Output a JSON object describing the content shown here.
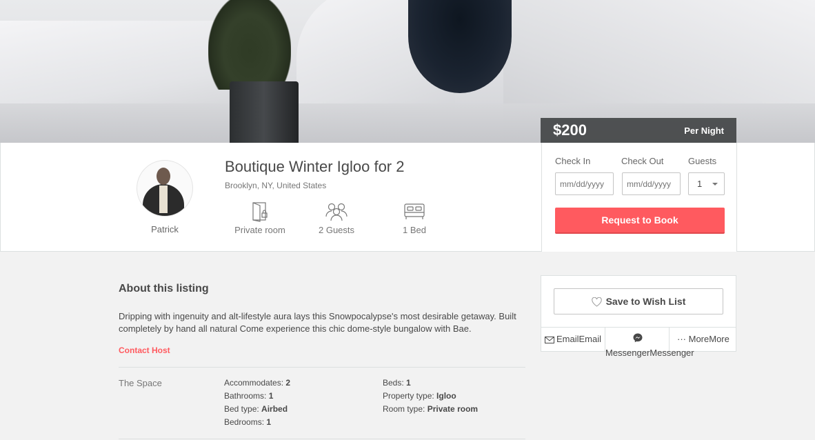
{
  "hero": {
    "price": "$200",
    "price_unit": "Per Night"
  },
  "host": {
    "name": "Patrick"
  },
  "listing": {
    "title": "Boutique Winter Igloo for 2",
    "location": "Brooklyn, NY, United States",
    "features": [
      {
        "icon": "door-icon",
        "label": "Private room"
      },
      {
        "icon": "guests-icon",
        "label": "2 Guests"
      },
      {
        "icon": "bed-icon",
        "label": "1 Bed"
      }
    ]
  },
  "booking": {
    "check_in_label": "Check In",
    "check_out_label": "Check Out",
    "guests_label": "Guests",
    "check_in_placeholder": "mm/dd/yyyy",
    "check_out_placeholder": "mm/dd/yyyy",
    "guests_value": "1",
    "request_button": "Request to Book"
  },
  "about": {
    "title": "About this listing",
    "description": "Dripping with ingenuity and alt-lifestyle aura lays this Snowpocalypse's most desirable getaway. Built completely by hand all natural Come experience this chic dome-style bungalow with Bae.",
    "contact_host": "Contact Host"
  },
  "space": {
    "label": "The Space",
    "left": [
      {
        "key": "Accommodates:",
        "value": "2"
      },
      {
        "key": "Bathrooms:",
        "value": "1"
      },
      {
        "key": "Bed type:",
        "value": "Airbed"
      },
      {
        "key": "Bedrooms:",
        "value": "1"
      }
    ],
    "right": [
      {
        "key": "Beds:",
        "value": "1"
      },
      {
        "key": "Property type:",
        "value": "Igloo"
      },
      {
        "key": "Room type:",
        "value": "Private room"
      }
    ]
  },
  "share": {
    "wish_list": "Save to Wish List",
    "email": "EmailEmail",
    "messenger": "MessengerMessenger",
    "more": "MoreMore"
  },
  "colors": {
    "accent": "#ff5a5f",
    "text": "#484848",
    "muted": "#767676"
  }
}
